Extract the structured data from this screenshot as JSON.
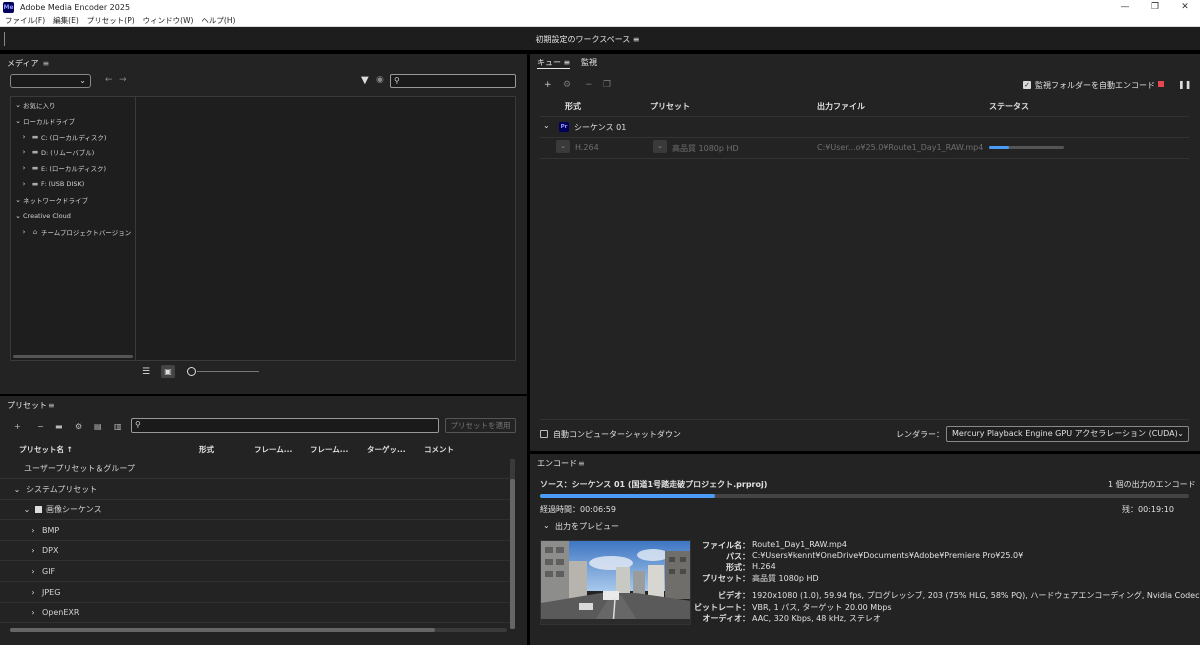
{
  "window": {
    "app_icon": "Me",
    "title": "Adobe Media Encoder 2025",
    "controls": {
      "minimize": "—",
      "restore": "❐",
      "close": "✕"
    }
  },
  "menu": [
    "ファイル(F)",
    "編集(E)",
    "プリセット(P)",
    "ウィンドウ(W)",
    "ヘルプ(H)"
  ],
  "workspace": {
    "title": "初期設定のワークスペース ≡"
  },
  "media": {
    "title": "メディア",
    "tree": [
      {
        "label": "お気に入り",
        "level": 0,
        "chev": "⌄",
        "icon": ""
      },
      {
        "label": "ローカルドライブ",
        "level": 0,
        "chev": "⌄",
        "icon": ""
      },
      {
        "label": "C: (ローカルディスク)",
        "level": 1,
        "chev": "›",
        "icon": "▬"
      },
      {
        "label": "D: (リムーバブル)",
        "level": 1,
        "chev": "›",
        "icon": "▬"
      },
      {
        "label": "E: (ローカルディスク)",
        "level": 1,
        "chev": "›",
        "icon": "▬"
      },
      {
        "label": "F: (USB DISK)",
        "level": 1,
        "chev": "›",
        "icon": "▬"
      },
      {
        "label": "ネットワークドライブ",
        "level": 0,
        "chev": "⌄",
        "icon": ""
      },
      {
        "label": "Creative Cloud",
        "level": 0,
        "chev": "⌄",
        "icon": ""
      },
      {
        "label": "チームプロジェクトバージョン",
        "level": 1,
        "chev": "›",
        "icon": "⌂"
      }
    ]
  },
  "preset": {
    "title": "プリセット",
    "apply_label": "プリセットを適用",
    "columns": [
      "プリセット名 ↑",
      "形式",
      "フレーム...",
      "フレーム...",
      "ターゲッ...",
      "コメント"
    ],
    "rows": [
      {
        "label": "ユーザープリセット＆グループ",
        "level": 0,
        "chev": ""
      },
      {
        "label": "システムプリセット",
        "level": 0,
        "chev": "⌄"
      },
      {
        "label": "画像シーケンス",
        "level": 1,
        "chev": "⌄"
      },
      {
        "label": "BMP",
        "level": 2,
        "chev": "›"
      },
      {
        "label": "DPX",
        "level": 2,
        "chev": "›"
      },
      {
        "label": "GIF",
        "level": 2,
        "chev": "›"
      },
      {
        "label": "JPEG",
        "level": 2,
        "chev": "›"
      },
      {
        "label": "OpenEXR",
        "level": 2,
        "chev": "›"
      }
    ]
  },
  "queue": {
    "tabs": [
      "キュー",
      "監視"
    ],
    "auto_encode_label": "監視フォルダーを自動エンコード",
    "columns": [
      "形式",
      "プリセット",
      "出力ファイル",
      "ステータス"
    ],
    "sequence_name": "シーケンス 01",
    "item": {
      "format": "H.264",
      "preset": "高品質 1080p HD",
      "output": "C:¥User...o¥25.0¥Route1_Day1_RAW.mp4",
      "progress": 0.27
    },
    "shutdown_label": "自動コンピューターシャットダウン",
    "renderer_label": "レンダラー：",
    "renderer_value": "Mercury Playback Engine GPU アクセラレーション (CUDA)"
  },
  "encode": {
    "title": "エンコード",
    "source": "ソース：シーケンス 01 (国道1号踏走破プロジェクト.prproj)",
    "outputs": "1 個の出力のエンコード",
    "progress": 0.27,
    "elapsed": "経過時間：00:06:59",
    "remaining": "残：00:19:10",
    "preview_label": "出力をプレビュー",
    "info": [
      {
        "key": "ファイル名：",
        "value": "Route1_Day1_RAW.mp4"
      },
      {
        "key": "パス：",
        "value": "C:¥Users¥kennt¥OneDrive¥Documents¥Adobe¥Premiere Pro¥25.0¥"
      },
      {
        "key": "形式：",
        "value": "H.264"
      },
      {
        "key": "プリセット：",
        "value": "高品質 1080p HD"
      },
      {
        "key": "ビデオ：",
        "value": "1920x1080 (1.0), 59.94 fps, プログレッシブ, 203 (75% HLG, 58% PQ), ハードウェアエンコーディング, Nvidia Codec..."
      },
      {
        "key": "ビットレート：",
        "value": "VBR, 1 パス, ターゲット 20.00 Mbps"
      },
      {
        "key": "オーディオ：",
        "value": "AAC, 320 Kbps, 48 kHz, ステレオ"
      }
    ]
  },
  "colors": {
    "accent": "#4b9cf5",
    "stop": "#e34850",
    "panel": "#232323"
  }
}
